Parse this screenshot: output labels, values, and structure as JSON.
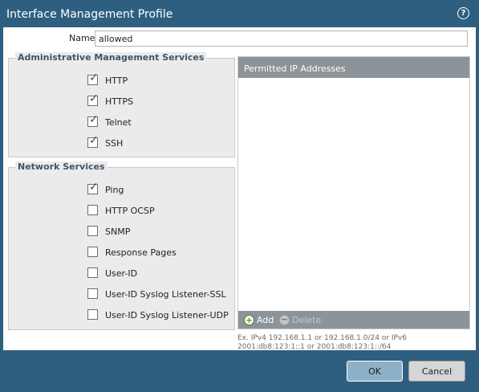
{
  "dialog": {
    "title": "Interface Management Profile",
    "help_icon": "?"
  },
  "name_field": {
    "label": "Name",
    "value": "allowed"
  },
  "admin_services": {
    "legend": "Administrative Management Services",
    "items": [
      {
        "label": "HTTP",
        "checked": true
      },
      {
        "label": "HTTPS",
        "checked": true
      },
      {
        "label": "Telnet",
        "checked": true
      },
      {
        "label": "SSH",
        "checked": true
      }
    ]
  },
  "network_services": {
    "legend": "Network Services",
    "items": [
      {
        "label": "Ping",
        "checked": true
      },
      {
        "label": "HTTP OCSP",
        "checked": false
      },
      {
        "label": "SNMP",
        "checked": false
      },
      {
        "label": "Response Pages",
        "checked": false
      },
      {
        "label": "User-ID",
        "checked": false
      },
      {
        "label": "User-ID Syslog Listener-SSL",
        "checked": false
      },
      {
        "label": "User-ID Syslog Listener-UDP",
        "checked": false
      }
    ]
  },
  "permitted_ips": {
    "header": "Permitted IP Addresses",
    "entries": [],
    "add_label": "Add",
    "delete_label": "Delete",
    "hint": "Ex. IPv4 192.168.1.1 or 192.168.1.0/24 or IPv6 2001:db8:123:1::1 or 2001:db8:123:1::/64"
  },
  "buttons": {
    "ok": "OK",
    "cancel": "Cancel"
  },
  "colors": {
    "title_bar": "#2e5f80",
    "panel_header": "#8c9399",
    "ok_button": "#8fb1c7"
  }
}
